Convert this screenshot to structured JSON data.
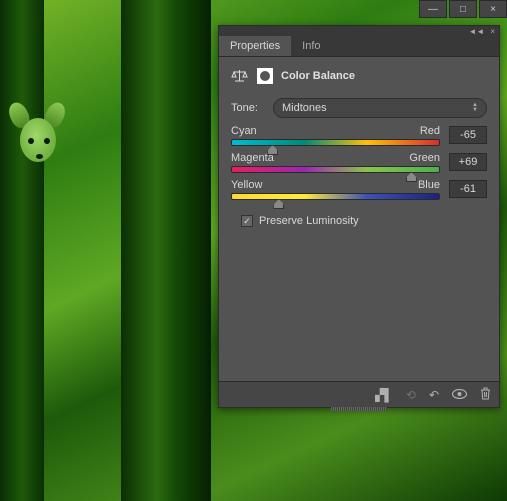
{
  "topbar": {
    "minimize": "—",
    "maximize": "□",
    "close": "×"
  },
  "panel_controls": {
    "collapse": "◄◄",
    "close": "×"
  },
  "tabs": {
    "properties": "Properties",
    "info": "Info"
  },
  "header": {
    "title": "Color Balance"
  },
  "tone": {
    "label": "Tone:",
    "value": "Midtones"
  },
  "sliders": [
    {
      "left": "Cyan",
      "right": "Red",
      "value": "-65",
      "pos": 17
    },
    {
      "left": "Magenta",
      "right": "Green",
      "value": "+69",
      "pos": 84
    },
    {
      "left": "Yellow",
      "right": "Blue",
      "value": "-61",
      "pos": 20
    }
  ],
  "preserve": {
    "label": "Preserve Luminosity",
    "checked": true
  },
  "footer_icons": {
    "clip": "▞▌",
    "link": "⟲",
    "reset": "↶",
    "visibility": "👁",
    "delete": "🗑"
  }
}
